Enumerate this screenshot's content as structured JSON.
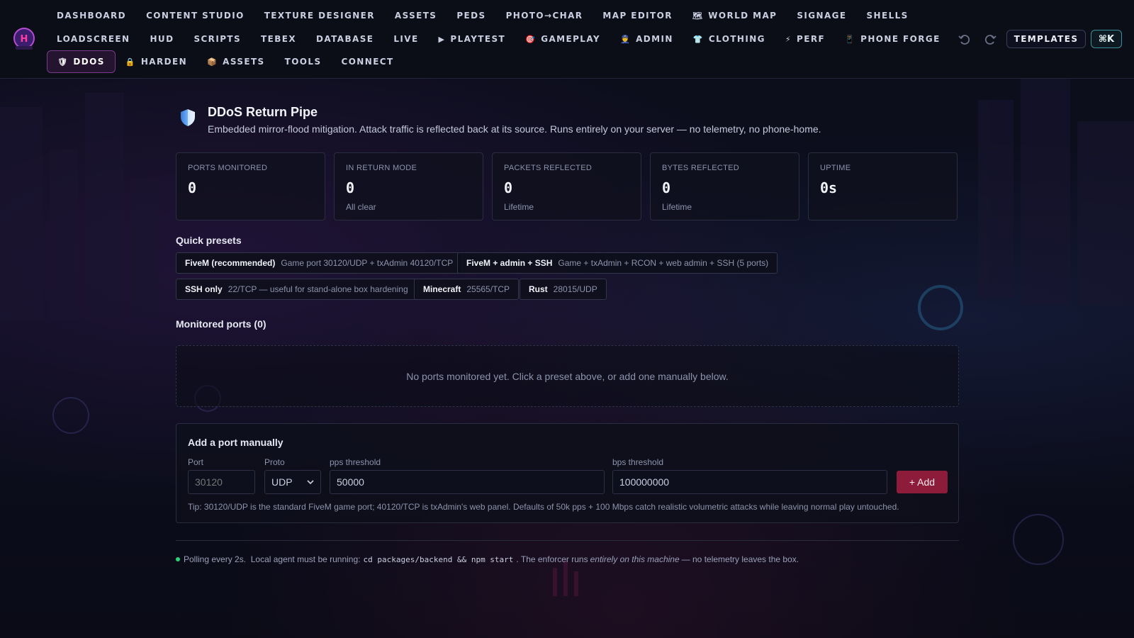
{
  "nav": {
    "row1": [
      {
        "label": "DASHBOARD",
        "icon": ""
      },
      {
        "label": "CONTENT STUDIO",
        "icon": ""
      },
      {
        "label": "TEXTURE DESIGNER",
        "icon": ""
      },
      {
        "label": "ASSETS",
        "icon": ""
      },
      {
        "label": "PEDS",
        "icon": ""
      },
      {
        "label": "PHOTO→CHAR",
        "icon": ""
      },
      {
        "label": "MAP EDITOR",
        "icon": ""
      },
      {
        "label": "WORLD MAP",
        "icon": "🗺"
      },
      {
        "label": "SIGNAGE",
        "icon": ""
      },
      {
        "label": "SHELLS",
        "icon": ""
      }
    ],
    "row2": [
      {
        "label": "LOADSCREEN",
        "icon": ""
      },
      {
        "label": "HUD",
        "icon": ""
      },
      {
        "label": "SCRIPTS",
        "icon": ""
      },
      {
        "label": "TEBEX",
        "icon": ""
      },
      {
        "label": "DATABASE",
        "icon": ""
      },
      {
        "label": "LIVE",
        "icon": ""
      },
      {
        "label": "PLAYTEST",
        "icon": "▶"
      },
      {
        "label": "GAMEPLAY",
        "icon": "🎯"
      },
      {
        "label": "ADMIN",
        "icon": "👮"
      },
      {
        "label": "CLOTHING",
        "icon": "👕"
      },
      {
        "label": "PERF",
        "icon": "⚡"
      },
      {
        "label": "PHONE FORGE",
        "icon": "📱"
      }
    ],
    "row3": [
      {
        "label": "DDOS",
        "icon": "🛡"
      },
      {
        "label": "HARDEN",
        "icon": "🔒"
      },
      {
        "label": "ASSETS",
        "icon": "📦"
      },
      {
        "label": "TOOLS",
        "icon": ""
      },
      {
        "label": "CONNECT",
        "icon": ""
      }
    ],
    "active": "DDOS",
    "templates_label": "TEMPLATES",
    "cmdk_label": "⌘K",
    "undo_icon": "undo-icon",
    "redo_icon": "redo-icon"
  },
  "hero": {
    "title": "DDoS Return Pipe",
    "subtitle": "Embedded mirror-flood mitigation. Attack traffic is reflected back at its source. Runs entirely on your server — no telemetry, no phone-home."
  },
  "stats": [
    {
      "label": "PORTS MONITORED",
      "value": "0",
      "sub": ""
    },
    {
      "label": "IN RETURN MODE",
      "value": "0",
      "sub": "All clear"
    },
    {
      "label": "PACKETS REFLECTED",
      "value": "0",
      "sub": "Lifetime"
    },
    {
      "label": "BYTES REFLECTED",
      "value": "0",
      "sub": "Lifetime"
    },
    {
      "label": "UPTIME",
      "value": "0s",
      "sub": ""
    }
  ],
  "presets": {
    "title": "Quick presets",
    "items": [
      {
        "name": "FiveM (recommended)",
        "desc": "Game port 30120/UDP + txAdmin 40120/TCP"
      },
      {
        "name": "FiveM + admin + SSH",
        "desc": "Game + txAdmin + RCON + web admin + SSH (5 ports)"
      },
      {
        "name": "SSH only",
        "desc": "22/TCP — useful for stand-alone box hardening"
      },
      {
        "name": "Minecraft",
        "desc": "25565/TCP"
      },
      {
        "name": "Rust",
        "desc": "28015/UDP"
      }
    ]
  },
  "monitored": {
    "title": "Monitored ports (0)",
    "empty_text": "No ports monitored yet. Click a preset above, or add one manually below."
  },
  "add": {
    "title": "Add a port manually",
    "port_label": "Port",
    "port_placeholder": "30120",
    "proto_label": "Proto",
    "proto_value": "UDP",
    "pps_label": "pps threshold",
    "pps_value": "50000",
    "bps_label": "bps threshold",
    "bps_value": "100000000",
    "add_label": "+ Add",
    "tip": "Tip: 30120/UDP is the standard FiveM game port; 40120/TCP is txAdmin's web panel. Defaults of 50k pps + 100 Mbps catch realistic volumetric attacks while leaving normal play untouched."
  },
  "footer": {
    "polling": "Polling every 2s.",
    "agent": "Local agent must be running:",
    "command": "cd packages/backend && npm start",
    "enforcer_pre": ". The enforcer runs",
    "enforcer_em": "entirely on this machine",
    "enforcer_post": "— no telemetry leaves the box.",
    "status_color": "#2bd47a"
  }
}
